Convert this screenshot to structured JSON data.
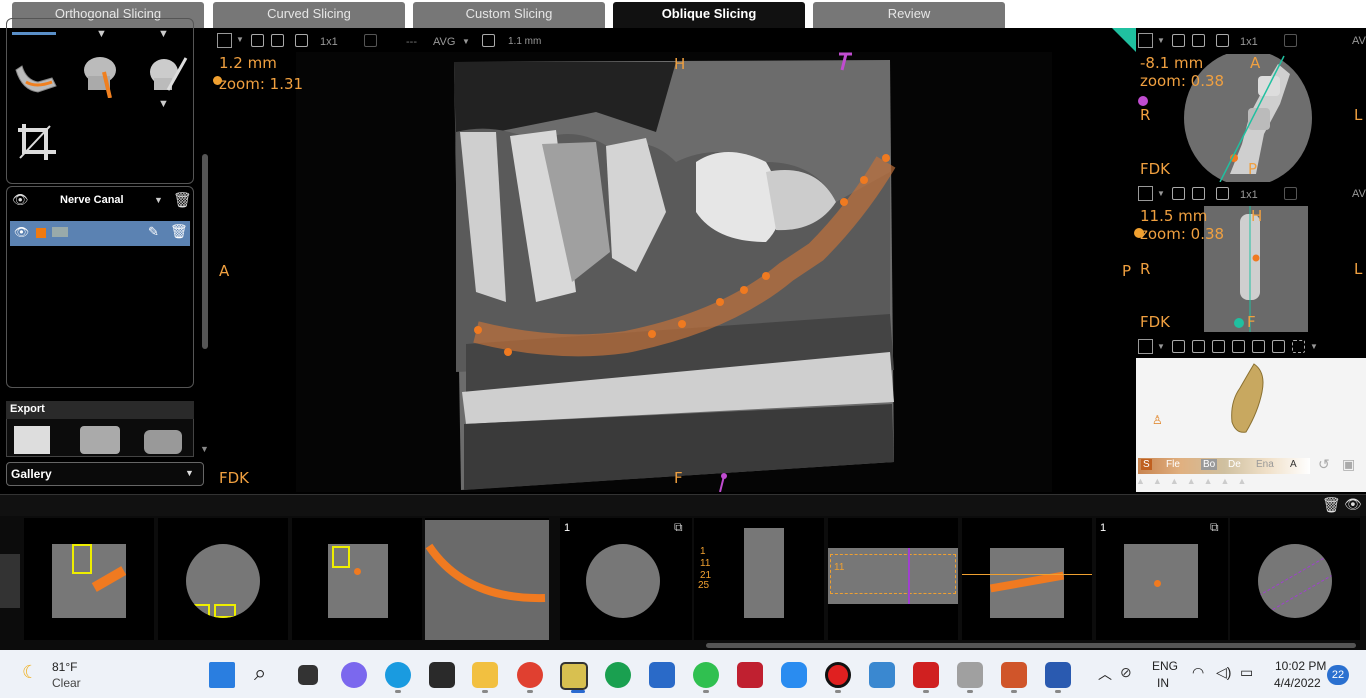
{
  "tabs": [
    "Orthogonal Slicing",
    "Curved Slicing",
    "Custom Slicing",
    "Oblique Slicing",
    "Review"
  ],
  "active_tab": 3,
  "left_panel": {
    "nerve_label": "Nerve Canal",
    "export_label": "Export",
    "gallery_label": "Gallery"
  },
  "main_view": {
    "toolbar": {
      "layout": "1x1",
      "dash": "---",
      "mode": "AVG",
      "thickness": "1.1 mm"
    },
    "thickness_text": "1.2 mm",
    "zoom_text": "zoom: 1.31",
    "label_top": "H",
    "label_left": "A",
    "label_right": "P",
    "label_bottom": "F",
    "label_fdk": "FDK"
  },
  "view_axial": {
    "layout": "1x1",
    "dist": "-8.1 mm",
    "zoom": "zoom: 0.38",
    "top": "A",
    "left": "R",
    "right": "L",
    "bottom": "P",
    "fdk": "FDK",
    "tb_right": "AV"
  },
  "view_coronal": {
    "layout": "1x1",
    "dist": "11.5 mm",
    "zoom": "zoom: 0.38",
    "top": "H",
    "left": "R",
    "right": "L",
    "bottom": "F",
    "fdk": "FDK",
    "tb_right": "AV"
  },
  "volume_view": {
    "presets": [
      "S",
      "Fle",
      "Bo",
      "De",
      "Ena",
      "A"
    ]
  },
  "filmstrip": {
    "counter_a": "1",
    "counter_b": "1",
    "labels": [
      "1",
      "11",
      "21",
      "25"
    ]
  },
  "taskbar": {
    "weather_temp": "81°F",
    "weather_desc": "Clear",
    "lang_top": "ENG",
    "lang_bottom": "IN",
    "time": "10:02 PM",
    "date": "4/4/2022",
    "notifications": "22"
  }
}
